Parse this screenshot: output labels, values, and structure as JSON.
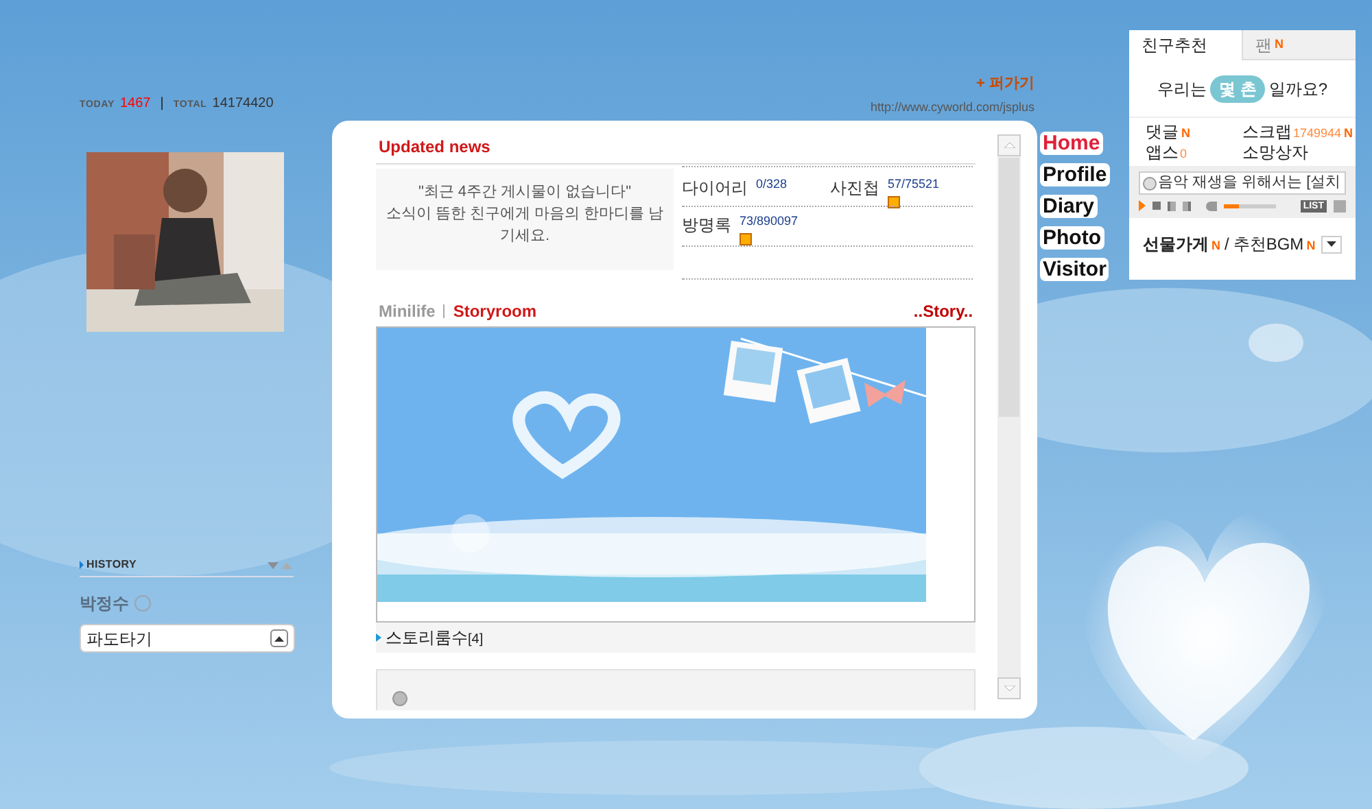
{
  "visitor_counter": {
    "today_label": "TODAY",
    "today": "1467",
    "separator": "|",
    "total_label": "TOTAL",
    "total": "14174420"
  },
  "history": {
    "title": "HISTORY",
    "name": "박정수"
  },
  "mood_select": {
    "value": "파도타기"
  },
  "header_links": {
    "scrap": "+ 퍼가기",
    "url": "http://www.cyworld.com/jsplus"
  },
  "updated_news": {
    "title": "Updated news",
    "message": [
      "\"최근 4주간 게시물이 없습니다\"",
      "소식이 뜸한 친구에게 마음의 한마디를 남기세요."
    ],
    "counts": [
      {
        "label": "다이어리",
        "value": "0/328",
        "new": false
      },
      {
        "label": "사진첩",
        "value": "57/75521",
        "new": true
      },
      {
        "label": "방명록",
        "value": "73/890097",
        "new": true
      }
    ]
  },
  "mini_tabs": [
    {
      "label": "Minilife",
      "selected": false
    },
    {
      "label": "Storyroom",
      "selected": true
    }
  ],
  "story_link": "..Story..",
  "storyroom": {
    "count_label": "스토리룸수",
    "count": "[4]"
  },
  "menu": [
    {
      "label": "Home"
    },
    {
      "label": "Profile"
    },
    {
      "label": "Diary"
    },
    {
      "label": "Photo"
    },
    {
      "label": "Visitor"
    }
  ],
  "side_panel": {
    "tabs": [
      {
        "label": "친구추천",
        "selected": true
      },
      {
        "label": "팬",
        "selected": false,
        "badge": "N"
      }
    ],
    "question": {
      "before": "우리는",
      "highlight": "몇 촌",
      "after": "일까요?"
    },
    "stats": [
      {
        "label": "댓글",
        "badge": "N"
      },
      {
        "label": "스크랩",
        "value": "1749944",
        "badge": "N"
      },
      {
        "label": "앱스",
        "value": "0"
      },
      {
        "label": "소망상자"
      }
    ],
    "player": {
      "marquee": "음악 재생을 위해서는 [설치",
      "level": 0.3,
      "list": "LIST"
    },
    "shop": {
      "label": "선물가게",
      "badge": "N"
    },
    "divider": "/",
    "bgm": {
      "label": "추천BGM",
      "badge": "N"
    }
  }
}
